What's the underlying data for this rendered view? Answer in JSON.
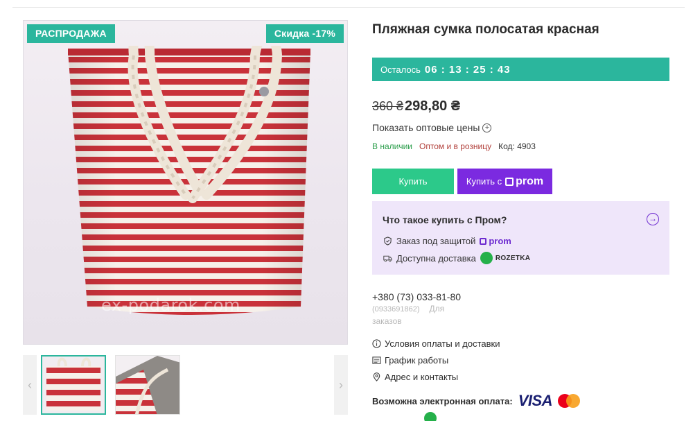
{
  "gallery": {
    "badge_sale": "РАСПРОДАЖА",
    "badge_discount": "Скидка -17%",
    "watermark": "ex-podarok.com",
    "prev_arrow": "‹",
    "next_arrow": "›"
  },
  "product": {
    "title": "Пляжная сумка полосатая красная",
    "timer_label": "Осталось",
    "timer_value": "06 : 13 : 25 : 43",
    "old_price": "360 ₴",
    "new_price": "298,80 ₴",
    "wholesale_link": "Показать оптовые цены",
    "in_stock": "В наличии",
    "retail": "Оптом и в розницу",
    "code": "Код: 4903",
    "buy_button": "Купить",
    "buy_prom_prefix": "Купить с",
    "prom_brand": "prom"
  },
  "prom_box": {
    "title": "Что такое купить с Пром?",
    "line1": "Заказ под защитой",
    "line2": "Доступна доставка",
    "rozetka": "ROZETKA"
  },
  "contacts": {
    "phone": "+380 (73) 033-81-80",
    "phone_alt": "(0933691862)",
    "phone_note": "Для заказов"
  },
  "links": {
    "payment_delivery": "Условия оплаты и доставки",
    "schedule": "График работы",
    "address": "Адрес и контакты"
  },
  "payment": {
    "label": "Возможна электронная оплата:",
    "visa": "VISA"
  },
  "colors": {
    "accent_teal": "#2bb69d",
    "buy_green": "#2cc98a",
    "prom_purple": "#7b2ae0",
    "prom_box_bg": "#efe6fa"
  }
}
